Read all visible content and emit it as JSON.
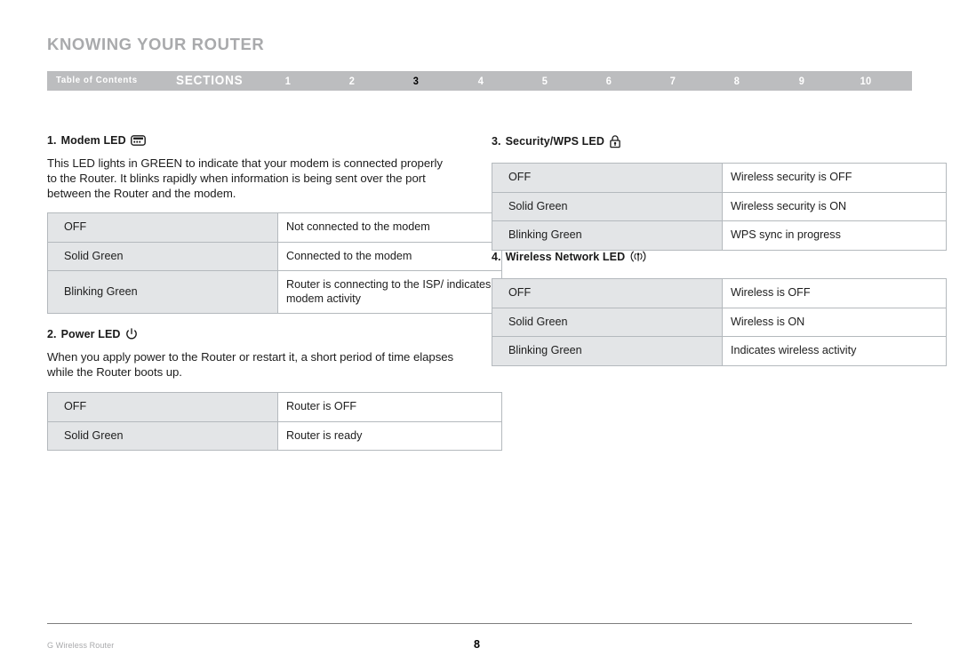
{
  "header": {
    "title": "KNOWING YOUR ROUTER",
    "nav": {
      "toc_label": "Table of Contents",
      "sections_label": "SECTIONS",
      "numbers": [
        "1",
        "2",
        "3",
        "4",
        "5",
        "6",
        "7",
        "8",
        "9",
        "10"
      ],
      "active_number": "3",
      "bar_color": "#bcbdbf",
      "text_color": "#ffffff",
      "active_color": "#000000"
    }
  },
  "sections": [
    {
      "number": "1.",
      "title": "Modem LED",
      "icon": "modem-icon",
      "body": "This LED lights in GREEN to indicate that your modem is connected properly to the Router. It blinks rapidly when information is being sent over the port between the Router and the modem.",
      "table": {
        "rows": [
          {
            "state": "OFF",
            "meaning": "Not connected to the modem"
          },
          {
            "state": "Solid Green",
            "meaning": "Connected to the modem"
          },
          {
            "state": "Blinking Green",
            "meaning": "Router is connecting to the ISP/ indicates modem activity"
          }
        ]
      }
    },
    {
      "number": "2.",
      "title": "Power LED",
      "icon": "power-icon",
      "body": "When you apply power to the Router or restart it, a short period of time elapses while the Router boots up.",
      "table": {
        "rows": [
          {
            "state": "OFF",
            "meaning": "Router is OFF"
          },
          {
            "state": "Solid Green",
            "meaning": "Router is ready"
          }
        ]
      }
    },
    {
      "number": "3.",
      "title": "Security/WPS LED",
      "icon": "lock-icon",
      "body": "",
      "table": {
        "rows": [
          {
            "state": "OFF",
            "meaning": "Wireless security is OFF"
          },
          {
            "state": "Solid Green",
            "meaning": "Wireless security is ON"
          },
          {
            "state": "Blinking Green",
            "meaning": "WPS sync in progress"
          }
        ]
      }
    },
    {
      "number": "4.",
      "title": "Wireless Network LED",
      "icon": "wireless-icon",
      "body": "",
      "table": {
        "rows": [
          {
            "state": "OFF",
            "meaning": "Wireless is OFF"
          },
          {
            "state": "Solid Green",
            "meaning": "Wireless is ON"
          },
          {
            "state": "Blinking Green",
            "meaning": "Indicates wireless activity"
          }
        ]
      }
    }
  ],
  "footer": {
    "product": "G Wireless Router",
    "page_number": "8"
  }
}
